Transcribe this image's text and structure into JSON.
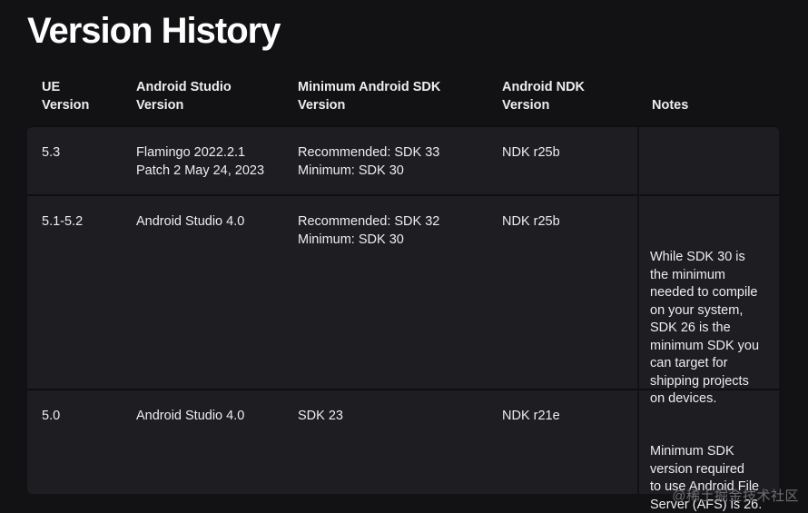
{
  "title": "Version History",
  "table": {
    "headers": [
      "UE\nVersion",
      "Android Studio\nVersion",
      "Minimum Android SDK\nVersion",
      "Android NDK\nVersion",
      "Notes"
    ],
    "rows": [
      {
        "ue": "5.3",
        "studio": "Flamingo 2022.2.1\nPatch 2 May 24, 2023",
        "sdk": "Recommended: SDK 33\nMinimum: SDK 30",
        "ndk": "NDK r25b",
        "notes": ""
      },
      {
        "ue": "5.1-5.2",
        "studio": "Android Studio 4.0",
        "sdk": "Recommended: SDK 32\nMinimum: SDK 30",
        "ndk": "NDK r25b",
        "notes": "While SDK 30 is\nthe minimum\nneeded to compile\non your system,\nSDK 26 is the\nminimum SDK you\ncan target for\nshipping projects\non devices."
      },
      {
        "ue": "5.0",
        "studio": "Android Studio 4.0",
        "sdk": "SDK 23",
        "ndk": "NDK r21e",
        "notes": "Minimum SDK\nversion required\nto use Android File\nServer (AFS) is 26."
      }
    ]
  },
  "watermark": "@稀土掘金技术社区"
}
